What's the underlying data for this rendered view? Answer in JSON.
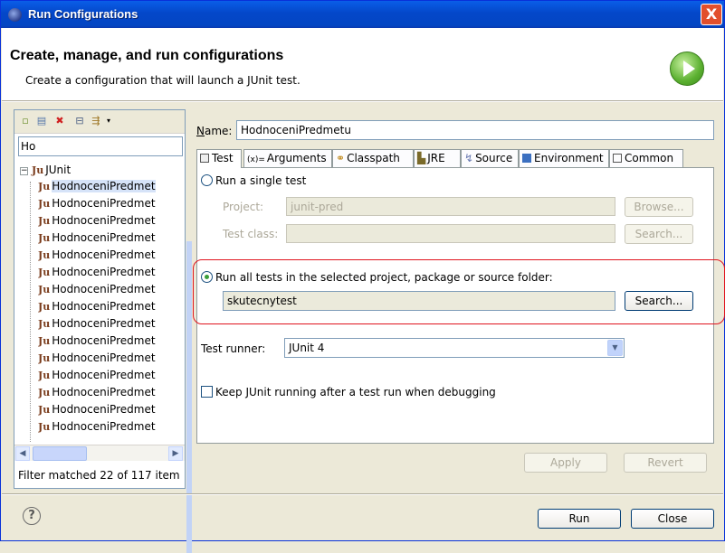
{
  "window": {
    "title": "Run Configurations",
    "close_glyph": "X"
  },
  "header": {
    "title": "Create, manage, and run configurations",
    "subtitle": "Create a configuration that will launch a JUnit test."
  },
  "left": {
    "toolbar_icons": [
      "new-config-icon",
      "duplicate-icon",
      "delete-icon",
      "collapse-all-icon",
      "filter-icon",
      "dropdown-icon"
    ],
    "filter_value": "Ho",
    "root_label": "JUnit",
    "root_prefix": "Ju",
    "items": [
      "HodnoceniPredmet",
      "HodnoceniPredmet",
      "HodnoceniPredmet",
      "HodnoceniPredmet",
      "HodnoceniPredmet",
      "HodnoceniPredmet",
      "HodnoceniPredmet",
      "HodnoceniPredmet",
      "HodnoceniPredmet",
      "HodnoceniPredmet",
      "HodnoceniPredmet",
      "HodnoceniPredmet",
      "HodnoceniPredmet",
      "HodnoceniPredmet",
      "HodnoceniPredmet"
    ],
    "filter_message": "Filter matched 22 of 117 item"
  },
  "right": {
    "name_label": "Name:",
    "name_value": "HodnoceniPredmetu",
    "tabs": [
      "Test",
      "Arguments",
      "Classpath",
      "JRE",
      "Source",
      "Environment",
      "Common"
    ],
    "run_single": "Run a single test",
    "project_label": "Project:",
    "project_value": "junit-pred",
    "browse_label": "Browse...",
    "test_class_label": "Test class:",
    "search_label_disabled": "Search...",
    "run_all": "Run all tests in the selected project, package or source folder:",
    "container_value": "skutecnytest",
    "search_label": "Search...",
    "test_runner_label": "Test runner:",
    "test_runner_value": "JUnit 4",
    "keep_running": "Keep JUnit running after a test run when debugging",
    "apply_label": "Apply",
    "revert_label": "Revert"
  },
  "footer": {
    "help_glyph": "?",
    "run_label": "Run",
    "close_label": "Close"
  }
}
